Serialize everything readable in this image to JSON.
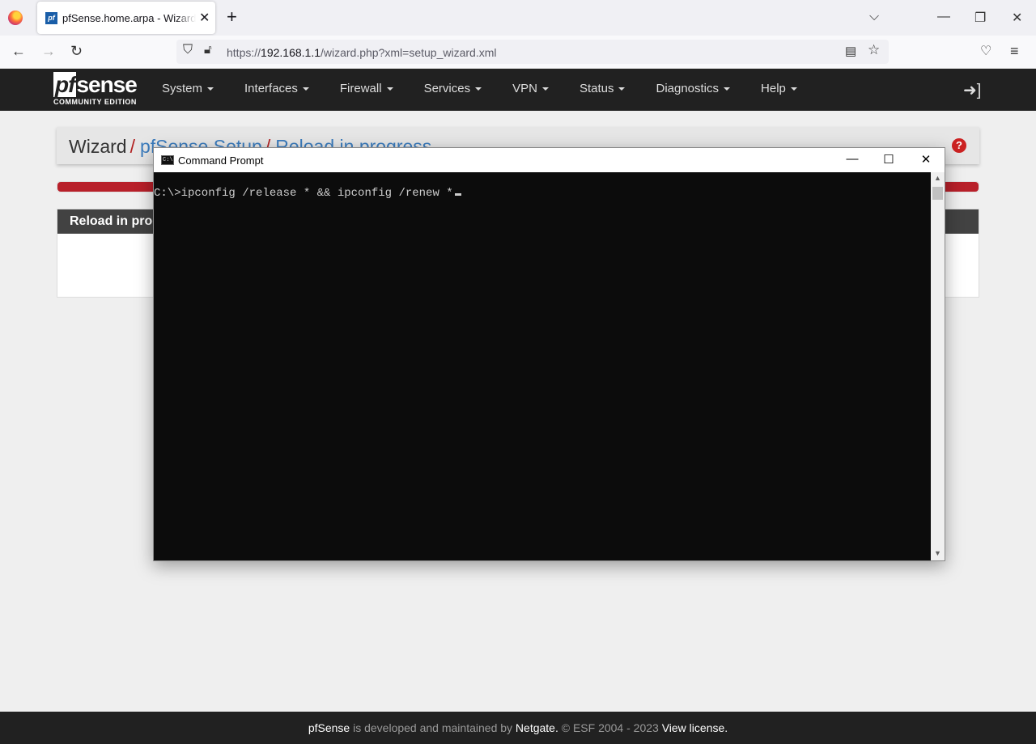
{
  "browser": {
    "tab_title": "pfSense.home.arpa - Wizard: pfSense Setup",
    "tab_favicon": "pf",
    "url_prefix": "https://",
    "url_host": "192.168.1.1",
    "url_path": "/wizard.php?xml=setup_wizard.xml"
  },
  "pfsense": {
    "logo_main_pf": "pf",
    "logo_main_rest": "sense",
    "logo_sub": "COMMUNITY EDITION",
    "menu": [
      "System",
      "Interfaces",
      "Firewall",
      "Services",
      "VPN",
      "Status",
      "Diagnostics",
      "Help"
    ],
    "breadcrumb": {
      "root": "Wizard",
      "sep": "/",
      "level1": "pfSense Setup",
      "level2": "Reload in progress"
    },
    "help_glyph": "?",
    "progress_percent": 100,
    "panel_heading": "Reload in progress"
  },
  "footer": {
    "brand": "pfSense",
    "text1": " is developed and maintained by ",
    "company": "Netgate.",
    "text2": " © ESF 2004 - 2023 ",
    "license": "View license."
  },
  "cmd": {
    "title": "Command Prompt",
    "icon_text": "C:\\",
    "line": "C:\\>ipconfig /release * && ipconfig /renew *"
  },
  "colors": {
    "pfsense_header": "#212121",
    "accent_red": "#b8202a",
    "link_blue": "#3c7cbd",
    "console_bg": "#0c0c0c"
  }
}
